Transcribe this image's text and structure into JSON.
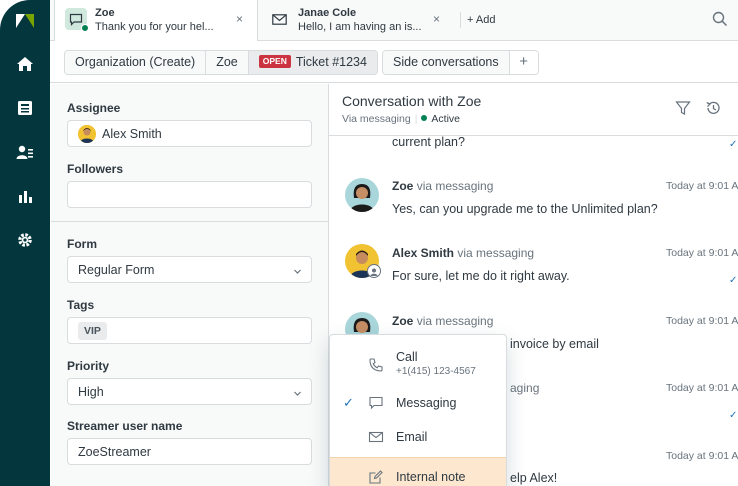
{
  "tabs": [
    {
      "name": "Zoe",
      "preview": "Thank you for your hel...",
      "close": "×"
    },
    {
      "name": "Janae Cole",
      "preview": "Hello, I am having an is...",
      "close": "×"
    }
  ],
  "add_tab_label": "+ Add",
  "breadcrumbs": [
    "Organization (Create)",
    "Zoe"
  ],
  "ticket": {
    "status": "OPEN",
    "label": "Ticket #1234"
  },
  "side_conversations": {
    "label": "Side conversations",
    "plus": "+"
  },
  "properties": {
    "assignee_label": "Assignee",
    "assignee_value": "Alex Smith",
    "followers_label": "Followers",
    "followers_value": "",
    "form_label": "Form",
    "form_value": "Regular Form",
    "tags_label": "Tags",
    "tag": "VIP",
    "priority_label": "Priority",
    "priority_value": "High",
    "streamer_label": "Streamer user name",
    "streamer_value": "ZoeStreamer"
  },
  "conversation": {
    "title": "Conversation with Zoe",
    "channel": "Via messaging",
    "status": "Active",
    "messages": [
      {
        "text": "current plan?"
      },
      {
        "author": "Zoe",
        "via": "via messaging",
        "time": "Today at 9:01 A",
        "text": "Yes, can you upgrade me to the Unlimited plan?"
      },
      {
        "author": "Alex Smith",
        "via": "via messaging",
        "time": "Today at 9:01 A",
        "text": "For sure, let me do it right away."
      },
      {
        "author": "Zoe",
        "via": "via messaging",
        "time": "Today at 9:01 A",
        "text": "invoice by email"
      },
      {
        "via": "aging",
        "time": "Today at 9:01 A"
      },
      {
        "time": "Today at 9:01 A",
        "text": "elp Alex!"
      }
    ]
  },
  "channel_menu": {
    "call_label": "Call",
    "call_number": "+1(415) 123-4567",
    "messaging_label": "Messaging",
    "email_label": "Email",
    "note_label": "Internal note",
    "checkmark": "✓"
  },
  "colors": {
    "rail": "#03363d",
    "brand_green": "#78a300",
    "active_green": "#038153",
    "open_badge": "#cc3340",
    "link_blue": "#1f73b7",
    "internal_note": "#fde8cf"
  },
  "icons": {
    "logo": "zendesk-logo",
    "nav": [
      "home-icon",
      "views-icon",
      "customers-icon",
      "reporting-icon",
      "admin-gear-icon"
    ],
    "tab_active": "chat-bubble-icon",
    "tab_second": "envelope-icon",
    "search": "search-icon",
    "filter": "filter-icon",
    "history": "history-icon"
  }
}
